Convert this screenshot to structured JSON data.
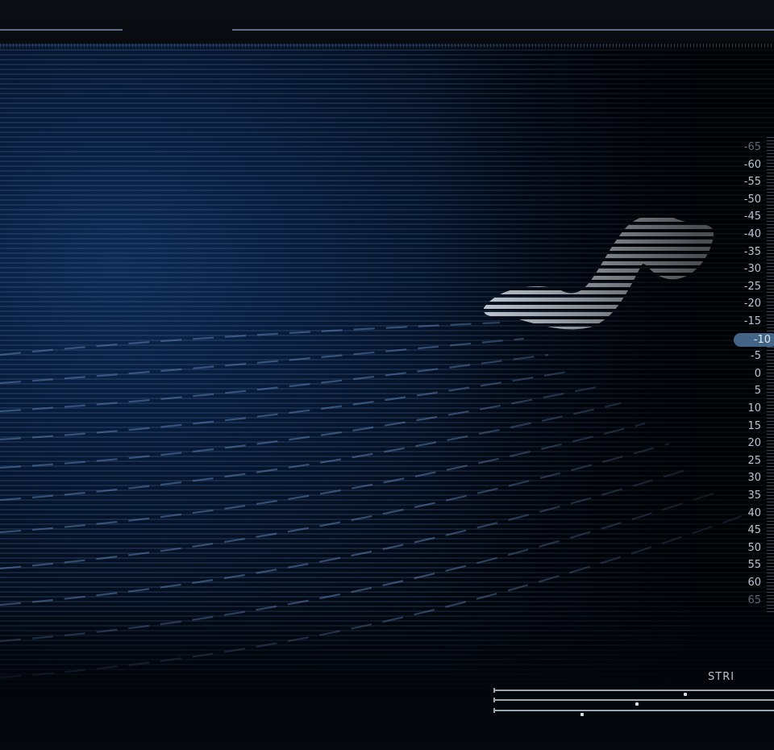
{
  "meter": {
    "scale_labels": [
      "-65",
      "-60",
      "-55",
      "-50",
      "-45",
      "-40",
      "-35",
      "-30",
      "-25",
      "-20",
      "-15",
      "-10",
      "-5",
      "0",
      "5",
      "10",
      "15",
      "20",
      "25",
      "30",
      "35",
      "40",
      "45",
      "50",
      "55",
      "60",
      "65"
    ],
    "highlighted_value": "-10"
  },
  "strip": {
    "label": "STRI"
  },
  "colors": {
    "accent": "#4a6f95",
    "background": "#081a36",
    "signal": "#dfe9f5"
  }
}
